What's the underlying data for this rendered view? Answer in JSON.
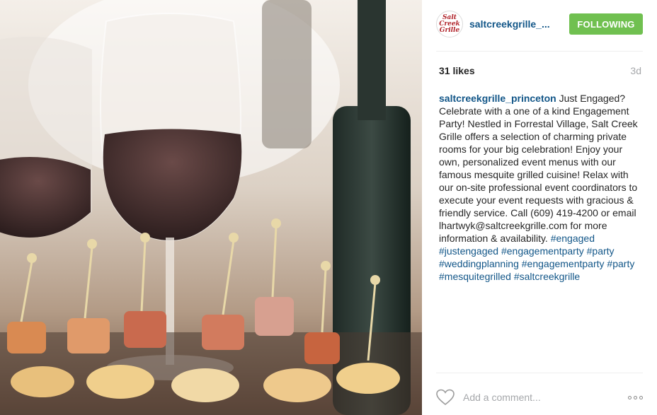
{
  "post": {
    "image_alt": "Wine glasses and appetizers on skewers",
    "avatar": {
      "text": "Salt Creek\nGrille"
    },
    "username": "saltcreekgrille_...",
    "follow_label": "FOLLOWING",
    "likes": "31 likes",
    "time": "3d",
    "caption": {
      "author": "saltcreekgrille_princeton",
      "text": " Just Engaged? Celebrate with a one of a kind Engagement Party! Nestled in Forrestal Village, Salt Creek Grille offers a selection of charming private rooms for your big celebration! Enjoy your own, personalized event menus with our famous mesquite grilled cuisine! Relax with our on-site professional event coordinators to execute your event requests with gracious & friendly service. Call (609) 419-4200 or email lhartwyk@saltcreekgrille.com for more information & availability. ",
      "tags": [
        "#engaged",
        "#justengaged",
        "#engagementparty",
        "#party",
        "#weddingplanning",
        "#engagementparty",
        "#party",
        "#mesquitegrilled",
        "#saltcreekgrille"
      ]
    },
    "comment_placeholder": "Add a comment...",
    "icons": {
      "like": "heart-icon",
      "more": "more-options-icon"
    },
    "colors": {
      "link": "#125688",
      "follow_bg": "#70c050",
      "muted": "#a5a7aa"
    }
  }
}
